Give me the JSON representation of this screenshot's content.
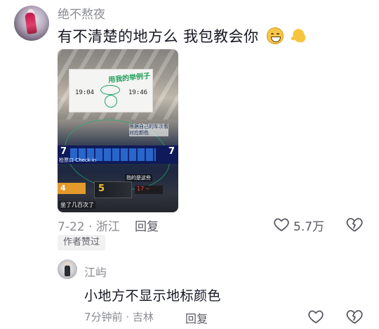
{
  "comment": {
    "username": "绝不熬夜",
    "text": "有不清楚的地方么 我包教会你",
    "emojis": [
      "grinning-sweat-emoji",
      "flexed-biceps-emoji"
    ],
    "image": {
      "annotation_top": "用我的举例子",
      "board_time_left": "19:04",
      "board_time_right": "19:46",
      "annotation_right": "根据自己的车次看对应颜色",
      "gate_number": "7",
      "checkin_label": "检票口 Check in",
      "guide_text": "指的是这些",
      "sign_left": "4",
      "sign_yellow": "5",
      "sign_red": "17 ─",
      "caption_bottom": "坐了几百次了"
    },
    "date_location": "7-22 · 浙江",
    "reply_label": "回复",
    "like_count": "5.7万",
    "author_badge": "作者赞过"
  },
  "reply": {
    "username": "江屿",
    "text": "小地方不显示地标颜色",
    "time_location": "7分钟前 · 吉林",
    "reply_label": "回复"
  },
  "colors": {
    "text_primary": "#161823",
    "text_secondary": "#8a8b91",
    "badge_bg": "#f1f1f2",
    "annotation_green": "#1e9e5a"
  }
}
